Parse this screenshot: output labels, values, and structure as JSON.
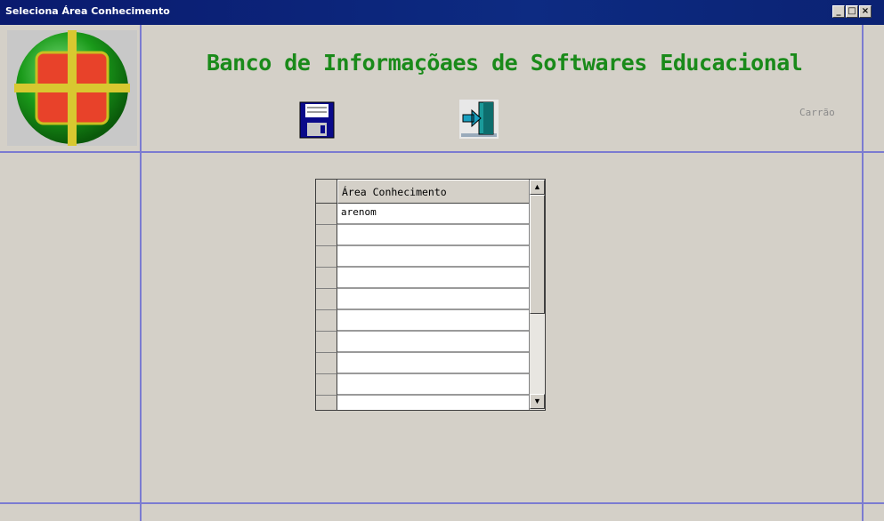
{
  "window": {
    "title": "Seleciona Área Conhecimento",
    "controls": {
      "minimize": "_",
      "maximize": "□",
      "close": "×"
    }
  },
  "header": {
    "app_title": "Banco de Informaçõaes de Softwares Educacional",
    "user": "Carrão",
    "toolbar": [
      {
        "name": "save",
        "icon": "floppy-disk-icon"
      },
      {
        "name": "exit",
        "icon": "exit-door-icon"
      }
    ]
  },
  "colors": {
    "title_green": "#1a8a1a",
    "divider": "#7b7bd1",
    "background": "#d4d0c8",
    "titlebar": "#0d2b82"
  },
  "grid": {
    "column_header": "Área Conhecimento",
    "rows": [
      "arenom",
      "",
      "",
      "",
      "",
      "",
      "",
      "",
      "",
      ""
    ]
  }
}
